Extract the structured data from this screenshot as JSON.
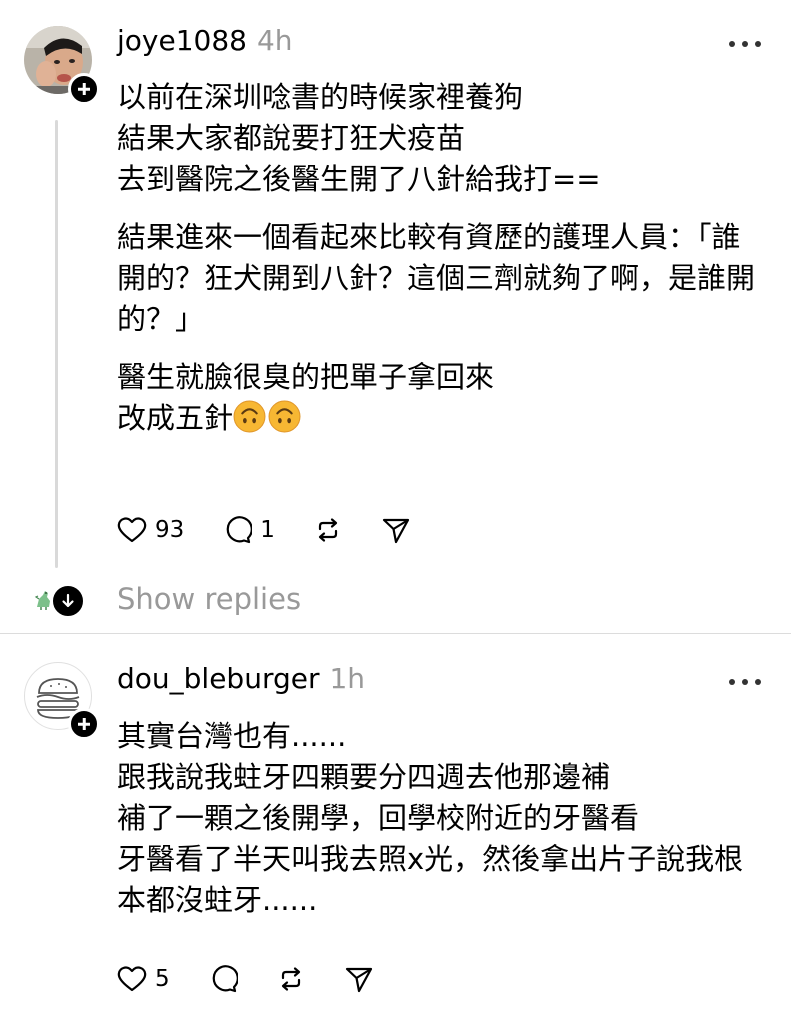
{
  "posts": [
    {
      "username": "joye1088",
      "time": "4h",
      "avatar_icon": "person-photo-avatar",
      "lines": [
        "以前在深圳唸書的時候家裡養狗",
        "結果大家都說要打狂犬疫苗",
        "去到醫院之後醫生開了八針給我打=="
      ],
      "lines2": [
        "結果進來一個看起來比較有資歷的護理人員：「誰",
        "開的？狂犬開到八針？這個三劑就夠了啊，是誰開",
        "的？」"
      ],
      "lines3": [
        "醫生就臉很臭的把單子拿回來",
        "改成五針"
      ],
      "emoji": "upside-down-face",
      "likes": "93",
      "comments": "1"
    },
    {
      "username": "dou_bleburger",
      "time": "1h",
      "avatar_icon": "burger-avatar",
      "lines": [
        "其實台灣也有......",
        "跟我說我蛀牙四顆要分四週去他那邊補",
        "補了一顆之後開學，回學校附近的牙醫看",
        "牙醫看了半天叫我去照x光，然後拿出片子說我根",
        "本都沒蛀牙......"
      ],
      "likes": "5"
    }
  ],
  "show_replies": "Show replies",
  "colors": {
    "secondary_text": "#999999",
    "divider": "#dcdcdc",
    "thread_line": "#d9d9d9"
  }
}
